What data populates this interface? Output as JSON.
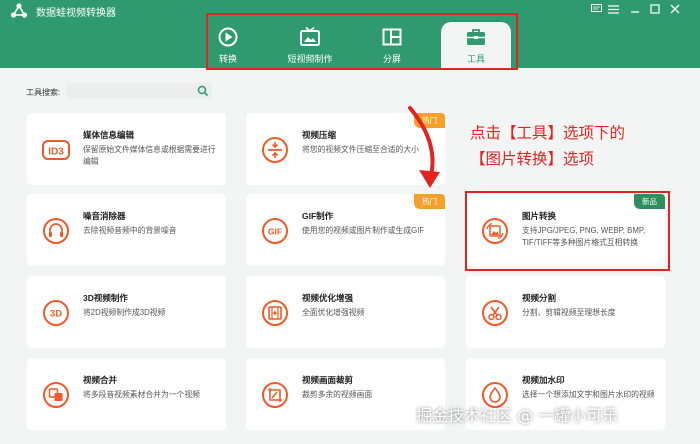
{
  "app": {
    "title": "数据蛙视频转换器"
  },
  "tabs": [
    {
      "label": "转换",
      "icon": "convert-icon"
    },
    {
      "label": "短视频制作",
      "icon": "tv-icon"
    },
    {
      "label": "分屏",
      "icon": "split-screen-icon"
    },
    {
      "label": "工具",
      "icon": "toolbox-icon",
      "active": true
    }
  ],
  "search": {
    "label": "工具搜索:",
    "placeholder": ""
  },
  "cards": [
    {
      "title": "媒体信息编辑",
      "desc": "保留原始文件媒体信息或根据需要进行编辑",
      "icon": "id3-icon",
      "icon_text": "ID3"
    },
    {
      "title": "视频压缩",
      "desc": "将您的视频文件压缩至合适的大小",
      "icon": "compress-icon",
      "badge": "热门"
    },
    {
      "title": "噪音消除器",
      "desc": "去除视频音频中的背景噪音",
      "icon": "noise-icon"
    },
    {
      "title": "GIF制作",
      "desc": "使用您的视频或图片制作或生成GIF",
      "icon": "gif-icon",
      "icon_text": "GIF",
      "badge": "热门"
    },
    {
      "title": "图片转换",
      "desc": "支持JPG/JPEG, PNG, WEBP, BMP, TIF/TIFF等多种图片格式互相转换",
      "icon": "image-convert-icon",
      "badge": "新品"
    },
    {
      "title": "3D视频制作",
      "desc": "将2D视频制作成3D视频",
      "icon": "3d-icon",
      "icon_text": "3D"
    },
    {
      "title": "视频优化增强",
      "desc": "全面优化增强视频",
      "icon": "enhance-icon"
    },
    {
      "title": "视频分割",
      "desc": "分割、剪辑视频至理想长度",
      "icon": "scissors-icon"
    },
    {
      "title": "视频合并",
      "desc": "将多段音视频素材合并为一个视频",
      "icon": "merge-icon"
    },
    {
      "title": "视频画面裁剪",
      "desc": "裁剪多余的视频画面",
      "icon": "crop-icon"
    },
    {
      "title": "视频加水印",
      "desc": "选择一个想添加文字和图片水印的视频",
      "icon": "watermark-icon"
    }
  ],
  "annotation": {
    "line1": "点击【工具】选项下的",
    "line2": "【图片转换】选项"
  },
  "watermark": "掘金技术社区 @ 一罐小可乐",
  "colors": {
    "header": "#2f9a6f",
    "accent": "#2f9a6f",
    "hot_badge": "#f5a02b",
    "new_badge": "#2e8f5e",
    "annotation": "#e3231f"
  }
}
